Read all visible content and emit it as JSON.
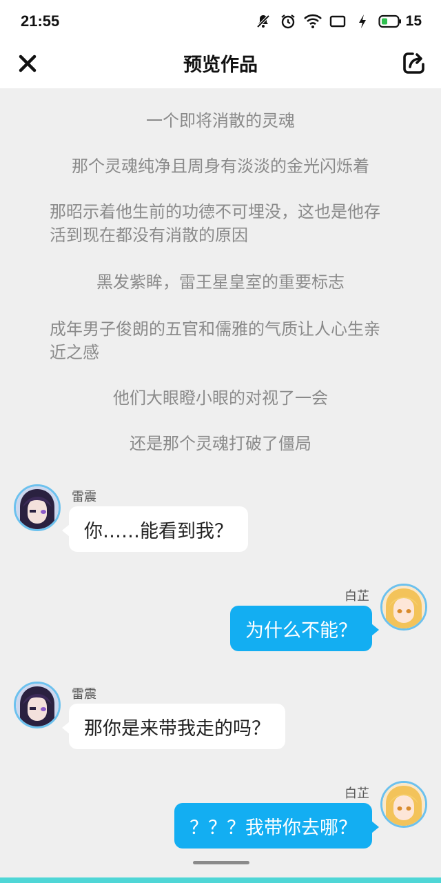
{
  "status_bar": {
    "time": "21:55",
    "battery_level": "15",
    "icons": [
      "mute-icon",
      "alarm-icon",
      "wifi-icon",
      "screen-icon",
      "charging-icon",
      "battery-icon"
    ]
  },
  "header": {
    "title": "预览作品",
    "close_icon": "close-icon",
    "share_icon": "share-icon"
  },
  "narration": [
    "一个即将消散的灵魂",
    "那个灵魂纯净且周身有淡淡的金光闪烁着",
    "那昭示着他生前的功德不可埋没，这也是他存活到现在都没有消散的原因",
    "黑发紫眸，雷王星皇室的重要标志",
    "成年男子俊朗的五官和儒雅的气质让人心生亲近之感",
    "他们大眼瞪小眼的对视了一会",
    "还是那个灵魂打破了僵局"
  ],
  "messages": [
    {
      "speaker": "雷震",
      "text": "你……能看到我？",
      "side": "left"
    },
    {
      "speaker": "白芷",
      "text": "为什么不能？",
      "side": "right"
    },
    {
      "speaker": "雷震",
      "text": "那你是来带我走的吗？",
      "side": "left"
    },
    {
      "speaker": "白芷",
      "text": "？？？我带你去哪？",
      "side": "right"
    }
  ],
  "colors": {
    "background": "#efefef",
    "bubble_right": "#13aef2",
    "bubble_left": "#ffffff",
    "narration_text": "#8a8a8a",
    "avatar_border": "#6cc1ee"
  }
}
